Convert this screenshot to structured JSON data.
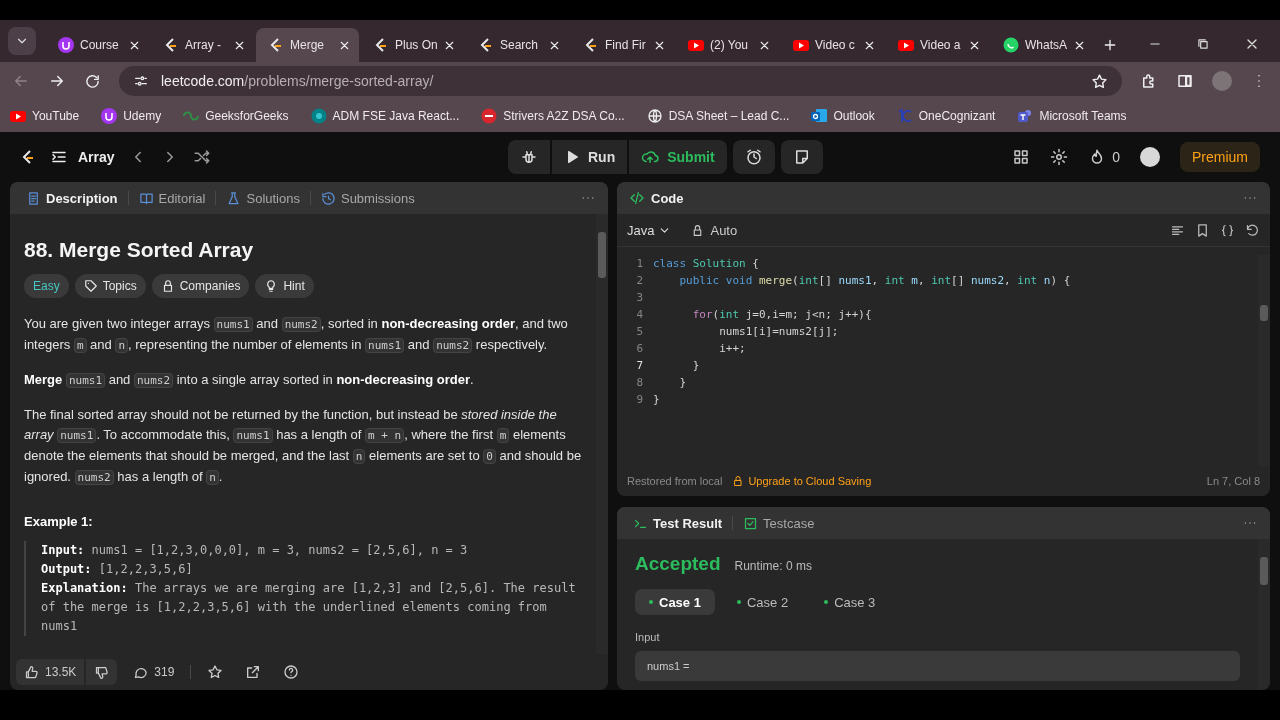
{
  "browser": {
    "tabs": [
      {
        "title": "Course",
        "kind": "udemy",
        "selected": false
      },
      {
        "title": "Array -",
        "kind": "leetcode",
        "selected": false
      },
      {
        "title": "Merge",
        "kind": "leetcode",
        "selected": true
      },
      {
        "title": "Plus On",
        "kind": "leetcode",
        "selected": false
      },
      {
        "title": "Search",
        "kind": "leetcode",
        "selected": false
      },
      {
        "title": "Find Fir",
        "kind": "leetcode",
        "selected": false
      },
      {
        "title": "(2) You",
        "kind": "youtube",
        "selected": false
      },
      {
        "title": "Video c",
        "kind": "youtube",
        "selected": false
      },
      {
        "title": "Video a",
        "kind": "youtube",
        "selected": false
      },
      {
        "title": "WhatsA",
        "kind": "whatsapp",
        "selected": false
      }
    ],
    "address": {
      "host": "leetcode.com",
      "path": "/problems/merge-sorted-array/"
    },
    "bookmarks": [
      {
        "label": "YouTube",
        "kind": "youtube"
      },
      {
        "label": "Udemy",
        "kind": "udemy"
      },
      {
        "label": "GeeksforGeeks",
        "kind": "gfg"
      },
      {
        "label": "ADM FSE Java React...",
        "kind": "sharepoint"
      },
      {
        "label": "Strivers A2Z DSA Co...",
        "kind": "tuf"
      },
      {
        "label": "DSA Sheet – Lead C...",
        "kind": "globe"
      },
      {
        "label": "Outlook",
        "kind": "outlook"
      },
      {
        "label": "OneCognizant",
        "kind": "cognizant"
      },
      {
        "label": "Microsoft Teams",
        "kind": "teams"
      }
    ]
  },
  "nav": {
    "problem_list": "Array",
    "run": "Run",
    "submit": "Submit",
    "streak": "0",
    "premium": "Premium"
  },
  "description": {
    "tabs": [
      {
        "label": "Description",
        "kind": "doc",
        "selected": true
      },
      {
        "label": "Editorial",
        "kind": "book",
        "selected": false
      },
      {
        "label": "Solutions",
        "kind": "flask",
        "selected": false
      },
      {
        "label": "Submissions",
        "kind": "history",
        "selected": false
      }
    ],
    "title": "88. Merge Sorted Array",
    "tags": [
      {
        "label": "Easy",
        "kind": "difficulty"
      },
      {
        "label": "Topics",
        "kind": "tag"
      },
      {
        "label": "Companies",
        "kind": "lock"
      },
      {
        "label": "Hint",
        "kind": "bulb"
      }
    ],
    "paragraphs": [
      [
        {
          "kind": "text",
          "text": "You are given two integer arrays "
        },
        {
          "kind": "code",
          "text": "nums1"
        },
        {
          "kind": "text",
          "text": " and "
        },
        {
          "kind": "code",
          "text": "nums2"
        },
        {
          "kind": "text",
          "text": ", sorted in **non-decreasing order**, and two integers "
        },
        {
          "kind": "code",
          "text": "m"
        },
        {
          "kind": "text",
          "text": " and "
        },
        {
          "kind": "code",
          "text": "n"
        },
        {
          "kind": "text",
          "text": ", representing the number of elements in "
        },
        {
          "kind": "code",
          "text": "nums1"
        },
        {
          "kind": "text",
          "text": " and "
        },
        {
          "kind": "code",
          "text": "nums2"
        },
        {
          "kind": "text",
          "text": " respectively."
        }
      ],
      [
        {
          "kind": "text",
          "text": "**Merge** "
        },
        {
          "kind": "code",
          "text": "nums1"
        },
        {
          "kind": "text",
          "text": " and "
        },
        {
          "kind": "code",
          "text": "nums2"
        },
        {
          "kind": "text",
          "text": " into a single array sorted in **non-decreasing order**."
        }
      ],
      [
        {
          "kind": "text",
          "text": "The final sorted array should not be returned by the function, but instead be *stored inside the array* "
        },
        {
          "kind": "code",
          "text": "nums1"
        },
        {
          "kind": "text",
          "text": ". To accommodate this, "
        },
        {
          "kind": "code",
          "text": "nums1"
        },
        {
          "kind": "text",
          "text": " has a length of "
        },
        {
          "kind": "code",
          "text": "m + n"
        },
        {
          "kind": "text",
          "text": ", where the first "
        },
        {
          "kind": "code",
          "text": "m"
        },
        {
          "kind": "text",
          "text": " elements denote the elements that should be merged, and the last "
        },
        {
          "kind": "code",
          "text": "n"
        },
        {
          "kind": "text",
          "text": " elements are set to "
        },
        {
          "kind": "code",
          "text": "0"
        },
        {
          "kind": "text",
          "text": " and should be ignored. "
        },
        {
          "kind": "code",
          "text": "nums2"
        },
        {
          "kind": "text",
          "text": " has a length of "
        },
        {
          "kind": "code",
          "text": "n"
        },
        {
          "kind": "text",
          "text": "."
        }
      ]
    ],
    "example": {
      "heading": "Example 1:",
      "lines": [
        "**Input:** nums1 = [1,2,3,0,0,0], m = 3, nums2 = [2,5,6], n = 3",
        "**Output:** [1,2,2,3,5,6]",
        "**Explanation:** The arrays we are merging are [1,2,3] and [2,5,6]. The result of the merge is [1,2,2,3,5,6] with the underlined elements coming from nums1"
      ]
    },
    "footer": {
      "likes": "13.5K",
      "comments": "319"
    }
  },
  "code": {
    "title": "Code",
    "language": "Java",
    "mode": "Auto",
    "lines": [
      {
        "number": "1",
        "current": false,
        "tokens": [
          {
            "kind": "kw",
            "text": "class "
          },
          {
            "kind": "type",
            "text": "Solution"
          },
          {
            "kind": "plain",
            "text": " {"
          }
        ]
      },
      {
        "number": "2",
        "current": false,
        "tokens": [
          {
            "kind": "kw",
            "text": "    public void "
          },
          {
            "kind": "fn",
            "text": "merge"
          },
          {
            "kind": "plain",
            "text": "("
          },
          {
            "kind": "type",
            "text": "int"
          },
          {
            "kind": "plain",
            "text": "[] "
          },
          {
            "kind": "var",
            "text": "nums1"
          },
          {
            "kind": "plain",
            "text": ", "
          },
          {
            "kind": "type",
            "text": "int "
          },
          {
            "kind": "var",
            "text": "m"
          },
          {
            "kind": "plain",
            "text": ", "
          },
          {
            "kind": "type",
            "text": "int"
          },
          {
            "kind": "plain",
            "text": "[] "
          },
          {
            "kind": "var",
            "text": "nums2"
          },
          {
            "kind": "plain",
            "text": ", "
          },
          {
            "kind": "type",
            "text": "int "
          },
          {
            "kind": "var",
            "text": "n"
          },
          {
            "kind": "plain",
            "text": ") {"
          }
        ]
      },
      {
        "number": "3",
        "current": false
      },
      {
        "number": "4",
        "current": false,
        "tokens": [
          {
            "kind": "ctrl",
            "text": "      for"
          },
          {
            "kind": "plain",
            "text": "("
          },
          {
            "kind": "type",
            "text": "int "
          },
          {
            "kind": "plain",
            "text": "j=0,i=m; j<n; j++){"
          }
        ]
      },
      {
        "number": "5",
        "current": false,
        "tokens": [
          {
            "kind": "plain",
            "text": "          nums1[i]=nums2[j];"
          }
        ]
      },
      {
        "number": "6",
        "current": false,
        "tokens": [
          {
            "kind": "plain",
            "text": "          i++;"
          }
        ]
      },
      {
        "number": "7",
        "current": true,
        "tokens": [
          {
            "kind": "plain",
            "text": "      }"
          }
        ]
      },
      {
        "number": "8",
        "current": false,
        "tokens": [
          {
            "kind": "plain",
            "text": "    }"
          }
        ]
      },
      {
        "number": "9",
        "current": false,
        "tokens": [
          {
            "kind": "plain",
            "text": "}"
          }
        ]
      }
    ],
    "status": "Restored from local",
    "upgrade": "Upgrade to Cloud Saving",
    "cursor": "Ln 7, Col 8"
  },
  "test_result": {
    "tabs": [
      {
        "label": "Test Result",
        "kind": "terminal",
        "selected": true
      },
      {
        "label": "Testcase",
        "kind": "check",
        "selected": false
      }
    ],
    "verdict": "Accepted",
    "runtime": "Runtime: 0 ms",
    "cases": [
      {
        "label": "Case 1",
        "selected": true,
        "passed": true
      },
      {
        "label": "Case 2",
        "selected": false,
        "passed": true
      },
      {
        "label": "Case 3",
        "selected": false,
        "passed": true
      }
    ],
    "input_label": "Input",
    "input_value": "nums1 ="
  }
}
